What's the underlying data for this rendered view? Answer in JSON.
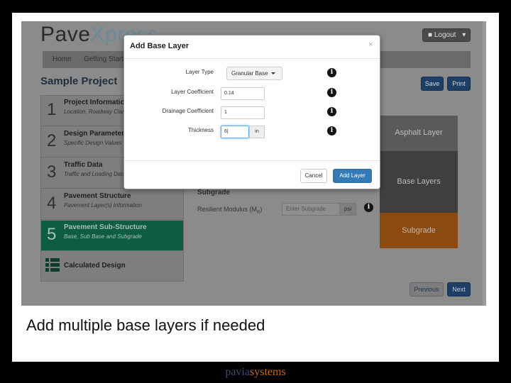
{
  "app": {
    "logo_part1": "Pave",
    "logo_part2": "Xpress",
    "logout_label": "Logout",
    "nav": [
      "Home",
      "Getting Started"
    ],
    "project_title": "Sample Project",
    "save_label": "Save",
    "print_label": "Print"
  },
  "steps": [
    {
      "num": "1",
      "title": "Project Information",
      "subtitle": "Location, Roadway Classification, Pavement Type"
    },
    {
      "num": "2",
      "title": "Design Parameters",
      "subtitle": "Specific Design Values"
    },
    {
      "num": "3",
      "title": "Traffic Data",
      "subtitle": "Traffic and Loading Data"
    },
    {
      "num": "4",
      "title": "Pavement Structure",
      "subtitle": "Pavement Layer(s) Information"
    },
    {
      "num": "5",
      "title": "Pavement Sub-Structure",
      "subtitle": "Base, Sub Base and Subgrade"
    },
    {
      "num": "",
      "title": "Calculated Design",
      "subtitle": ""
    }
  ],
  "layers": {
    "asphalt": "Asphalt Layer",
    "base": "Base Layers",
    "subgrade": "Subgrade"
  },
  "colors": {
    "asphalt": "#5a5a5a",
    "base": "#3f3f3f",
    "subgrade": "#8a4a10",
    "active_step": "#0e5c44",
    "primary": "#337ab7"
  },
  "substructure": {
    "subgrade_heading": "Subgrade",
    "resilient_label": "Resilient Modulus (M",
    "resilient_sub": "R",
    "resilient_close": ")",
    "input_placeholder": "Enter Subgrade",
    "unit": "psi"
  },
  "modal": {
    "title": "Add Base Layer",
    "close": "×",
    "fields": {
      "layer_type_label": "Layer Type",
      "layer_type_value": "Granular Base",
      "layer_coef_label": "Layer Coefficient",
      "layer_coef_value": "0.14",
      "drainage_label": "Drainage Coefficient",
      "drainage_value": "1",
      "thickness_label": "Thickness",
      "thickness_value": "6|",
      "thickness_unit": "in"
    },
    "cancel_label": "Cancel",
    "add_label": "Add Layer"
  },
  "pager": {
    "previous": "Previous",
    "next": "Next"
  },
  "caption": "Add multiple base layers if needed",
  "brand": {
    "part1": "pavia",
    "part2": "systems"
  }
}
